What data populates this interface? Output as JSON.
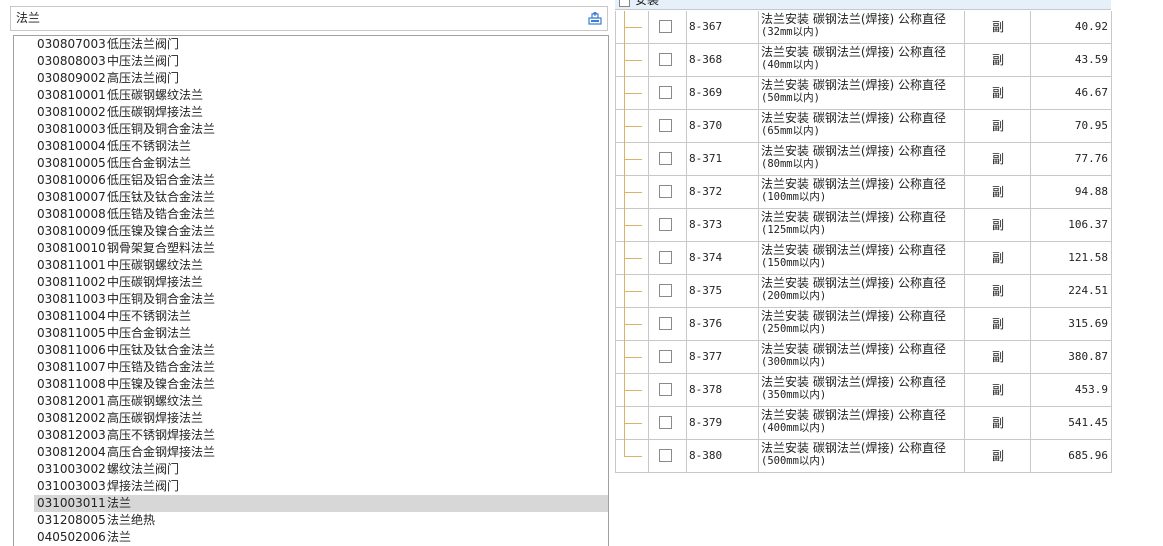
{
  "search": {
    "value": "法兰"
  },
  "list": [
    {
      "code": "030807003",
      "name": "低压法兰阀门"
    },
    {
      "code": "030808003",
      "name": "中压法兰阀门"
    },
    {
      "code": "030809002",
      "name": "高压法兰阀门"
    },
    {
      "code": "030810001",
      "name": "低压碳钢螺纹法兰"
    },
    {
      "code": "030810002",
      "name": "低压碳钢焊接法兰"
    },
    {
      "code": "030810003",
      "name": "低压铜及铜合金法兰"
    },
    {
      "code": "030810004",
      "name": "低压不锈钢法兰"
    },
    {
      "code": "030810005",
      "name": "低压合金钢法兰"
    },
    {
      "code": "030810006",
      "name": "低压铝及铝合金法兰"
    },
    {
      "code": "030810007",
      "name": "低压钛及钛合金法兰"
    },
    {
      "code": "030810008",
      "name": "低压锆及锆合金法兰"
    },
    {
      "code": "030810009",
      "name": "低压镍及镍合金法兰"
    },
    {
      "code": "030810010",
      "name": "钢骨架复合塑料法兰"
    },
    {
      "code": "030811001",
      "name": "中压碳钢螺纹法兰"
    },
    {
      "code": "030811002",
      "name": "中压碳钢焊接法兰"
    },
    {
      "code": "030811003",
      "name": "中压铜及铜合金法兰"
    },
    {
      "code": "030811004",
      "name": "中压不锈钢法兰"
    },
    {
      "code": "030811005",
      "name": "中压合金钢法兰"
    },
    {
      "code": "030811006",
      "name": "中压钛及钛合金法兰"
    },
    {
      "code": "030811007",
      "name": "中压锆及锆合金法兰"
    },
    {
      "code": "030811008",
      "name": "中压镍及镍合金法兰"
    },
    {
      "code": "030812001",
      "name": "高压碳钢螺纹法兰"
    },
    {
      "code": "030812002",
      "name": "高压碳钢焊接法兰"
    },
    {
      "code": "030812003",
      "name": "高压不锈钢焊接法兰"
    },
    {
      "code": "030812004",
      "name": "高压合金钢焊接法兰"
    },
    {
      "code": "031003002",
      "name": "螺纹法兰阀门"
    },
    {
      "code": "031003003",
      "name": "焊接法兰阀门"
    },
    {
      "code": "031003011",
      "name": "法兰"
    },
    {
      "code": "031208005",
      "name": "法兰绝热"
    },
    {
      "code": "040502006",
      "name": "法兰"
    }
  ],
  "selected_index": 27,
  "group": {
    "label": "安装"
  },
  "table": [
    {
      "code": "8-367",
      "name1": "法兰安装 碳钢法兰(焊接) 公称直径",
      "name2": "(32mm以内)",
      "unit": "副",
      "price": "40.92"
    },
    {
      "code": "8-368",
      "name1": "法兰安装 碳钢法兰(焊接) 公称直径",
      "name2": "(40mm以内)",
      "unit": "副",
      "price": "43.59"
    },
    {
      "code": "8-369",
      "name1": "法兰安装 碳钢法兰(焊接) 公称直径",
      "name2": "(50mm以内)",
      "unit": "副",
      "price": "46.67"
    },
    {
      "code": "8-370",
      "name1": "法兰安装 碳钢法兰(焊接) 公称直径",
      "name2": "(65mm以内)",
      "unit": "副",
      "price": "70.95"
    },
    {
      "code": "8-371",
      "name1": "法兰安装 碳钢法兰(焊接) 公称直径",
      "name2": "(80mm以内)",
      "unit": "副",
      "price": "77.76"
    },
    {
      "code": "8-372",
      "name1": "法兰安装 碳钢法兰(焊接) 公称直径",
      "name2": "(100mm以内)",
      "unit": "副",
      "price": "94.88"
    },
    {
      "code": "8-373",
      "name1": "法兰安装 碳钢法兰(焊接) 公称直径",
      "name2": "(125mm以内)",
      "unit": "副",
      "price": "106.37"
    },
    {
      "code": "8-374",
      "name1": "法兰安装 碳钢法兰(焊接) 公称直径",
      "name2": "(150mm以内)",
      "unit": "副",
      "price": "121.58"
    },
    {
      "code": "8-375",
      "name1": "法兰安装 碳钢法兰(焊接) 公称直径",
      "name2": "(200mm以内)",
      "unit": "副",
      "price": "224.51"
    },
    {
      "code": "8-376",
      "name1": "法兰安装 碳钢法兰(焊接) 公称直径",
      "name2": "(250mm以内)",
      "unit": "副",
      "price": "315.69"
    },
    {
      "code": "8-377",
      "name1": "法兰安装 碳钢法兰(焊接) 公称直径",
      "name2": "(300mm以内)",
      "unit": "副",
      "price": "380.87"
    },
    {
      "code": "8-378",
      "name1": "法兰安装 碳钢法兰(焊接) 公称直径",
      "name2": "(350mm以内)",
      "unit": "副",
      "price": "453.9"
    },
    {
      "code": "8-379",
      "name1": "法兰安装 碳钢法兰(焊接) 公称直径",
      "name2": "(400mm以内)",
      "unit": "副",
      "price": "541.45"
    },
    {
      "code": "8-380",
      "name1": "法兰安装 碳钢法兰(焊接) 公称直径",
      "name2": "(500mm以内)",
      "unit": "副",
      "price": "685.96"
    }
  ],
  "colors": {
    "selection": "#d7d7d7",
    "tree_line": "#d9b36c",
    "grid": "#c8c8c8",
    "header": "#e6f0fa"
  }
}
